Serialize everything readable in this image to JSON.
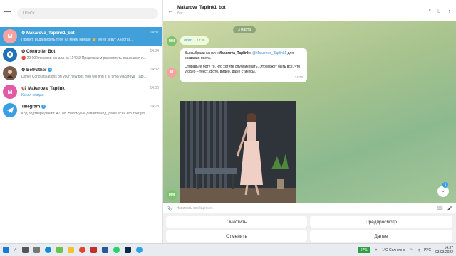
{
  "sidebar": {
    "search_placeholder": "Поиск",
    "chats": [
      {
        "avatar_letter": "M",
        "avatar_color": "#f4a3a0",
        "title": "Makarova_Taplink1_bot",
        "time": "14:37",
        "preview": "Привет, рада видеть тебя на моем канале 👋 Меня зовут Анастас...",
        "active": true
      },
      {
        "avatar_letter": "",
        "avatar_color": "#1f71b8",
        "title": "Controller Bot",
        "time": "14:34",
        "preview": "🔴 20 000 показов канала за 1140 ₽ Предлагаем разместить ваш канал п..."
      },
      {
        "avatar_letter": "",
        "avatar_color": "#7a5a4a",
        "title": "BotFather",
        "time": "14:32",
        "preview": "Done! Congratulations on your new bot. You will find it at t.me/Makarova_Tapl..."
      },
      {
        "avatar_letter": "M",
        "avatar_color": "#e05aa4",
        "title": "Makarova_Taplink",
        "time": "14:30",
        "preview": "Канал создан"
      },
      {
        "avatar_letter": "",
        "avatar_color": "#3a9ee6",
        "title": "Telegram",
        "time": "14:28",
        "preview": "Код подтверждения: 47188. Никому не давайте код, даже если его требую..."
      }
    ]
  },
  "header": {
    "title": "Makarova_Taplink1_bot",
    "subtitle": "бот"
  },
  "chat": {
    "date": "3 марта",
    "out_msg": "/start",
    "out_time": "14:35",
    "bot_avatar": "MM",
    "in_msg_line1_a": "Вы выбрали канал",
    "in_msg_channel": "«Makarova_Taplink»",
    "in_msg_link": "@Makarova_Taplink1",
    "in_msg_line1_b": "для создания поста.",
    "in_msg_line2": "Отправьте боту то, что хотите опубликовать. Это может быть всё, что угодно – текст, фото, видео, даже стикеры.",
    "in_time": "14:36",
    "unread_badge": "1"
  },
  "compose": {
    "placeholder": "Написать сообщение..."
  },
  "keyboard": {
    "clear": "Очистить",
    "preview": "Предпросмотр",
    "cancel": "Отменить",
    "next": "Далее"
  },
  "taskbar": {
    "battery": "97%",
    "weather": "1°C Солнечно",
    "lang": "РУС",
    "time": "14:37",
    "date": "03.03.2022"
  }
}
